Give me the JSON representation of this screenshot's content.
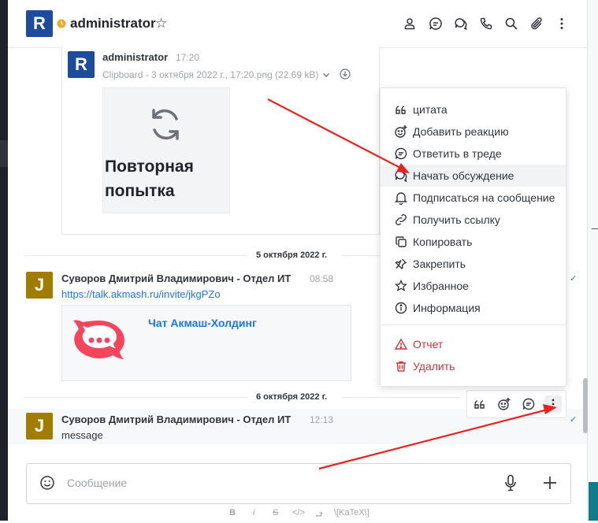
{
  "header": {
    "avatar_letter": "R",
    "room_name": "administrator"
  },
  "message1": {
    "avatar_letter": "R",
    "user": "administrator",
    "time": "17:20",
    "attachment_meta": "Clipboard - 3 октября 2022 г., 17:20.png (22.69 kB)",
    "retry_text": "Повторная попытка"
  },
  "dividers": {
    "date1": "5 октября 2022 г.",
    "date2": "6 октября 2022 г."
  },
  "message2": {
    "avatar_letter": "J",
    "user": "Суворов Дмитрий Владимирович - Отдел ИТ",
    "time": "08:58",
    "link": "https://talk.akmash.ru/invite/jkgPZo",
    "preview_title": "Чат Акмаш-Холдинг"
  },
  "message3": {
    "avatar_letter": "J",
    "user": "Суворов Дмитрий Владимирович - Отдел ИТ",
    "time": "12:13",
    "text": "message"
  },
  "menu": {
    "items": [
      {
        "label": "цитата",
        "icon": "quote-icon"
      },
      {
        "label": "Добавить реакцию",
        "icon": "add-reaction-icon"
      },
      {
        "label": "Ответить в треде",
        "icon": "thread-icon"
      },
      {
        "label": "Начать обсуждение",
        "icon": "discussion-icon"
      },
      {
        "label": "Подписаться на сообщение",
        "icon": "bell-icon"
      },
      {
        "label": "Получить ссылку",
        "icon": "link-icon"
      },
      {
        "label": "Копировать",
        "icon": "copy-icon"
      },
      {
        "label": "Закрепить",
        "icon": "pin-icon"
      },
      {
        "label": "Избранное",
        "icon": "star-icon"
      },
      {
        "label": "Информация",
        "icon": "info-icon"
      }
    ],
    "danger_items": [
      {
        "label": "Отчет",
        "icon": "warning-icon"
      },
      {
        "label": "Удалить",
        "icon": "trash-icon"
      }
    ]
  },
  "composer": {
    "placeholder": "Сообщение"
  },
  "format_bar": {
    "bold": "B",
    "italic": "i",
    "strike": "S",
    "code": "</>",
    "link": "⮐",
    "katex": "\\[KaTeX\\]"
  },
  "colors": {
    "avatar_blue": "#1d4c9b",
    "avatar_gold": "#a07d00",
    "link_blue": "#1d74f5",
    "danger_red": "#d1323c",
    "status_away": "#f5a623"
  }
}
